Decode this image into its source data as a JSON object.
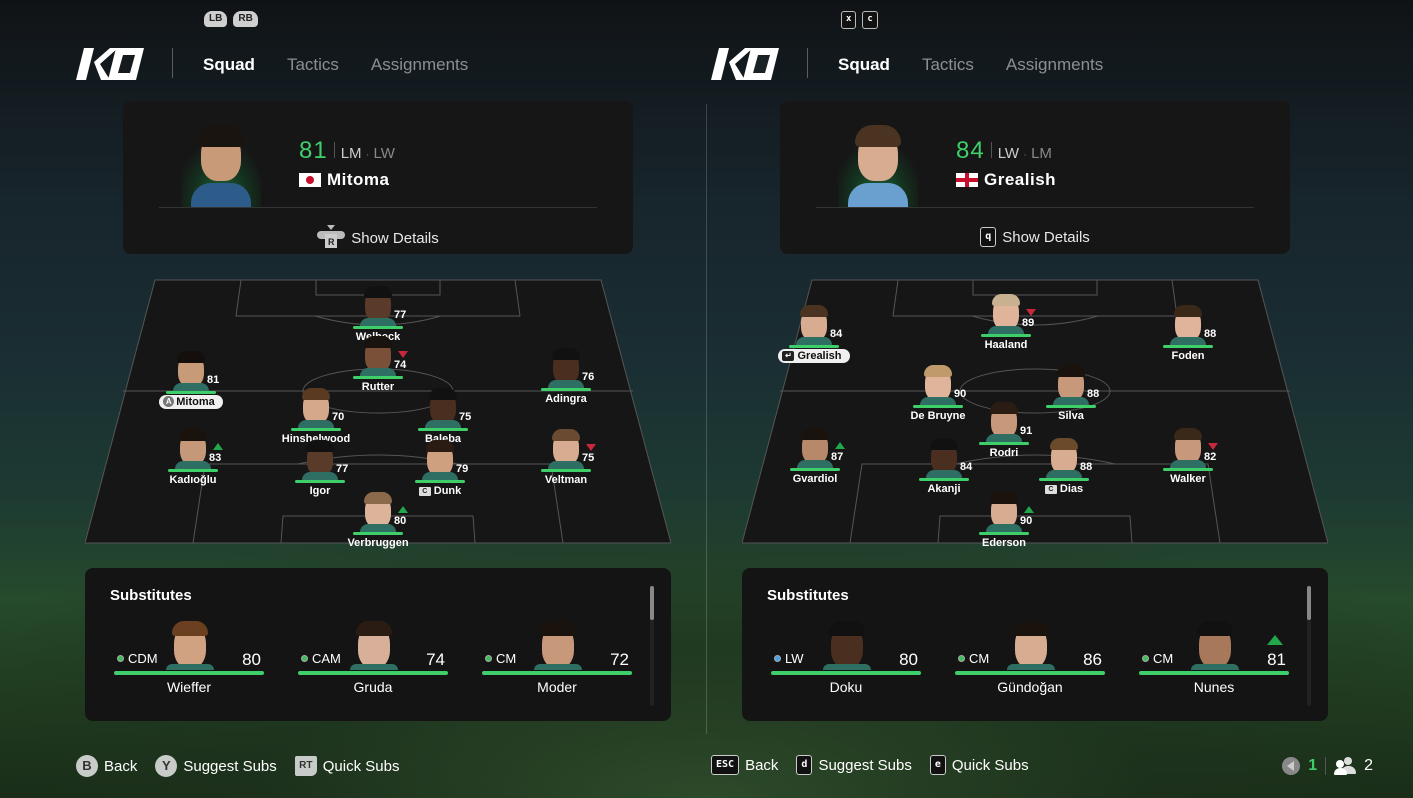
{
  "panels": [
    {
      "bumpers": [
        "LB",
        "RB"
      ],
      "tabs": [
        "Squad",
        "Tactics",
        "Assignments"
      ],
      "active_tab": "Squad",
      "selected_player": {
        "rating": "81",
        "primary_position": "LM",
        "secondary_position": "LW",
        "name": "Mitoma",
        "nationality_flag": "japan-flag",
        "details_hint": "R",
        "details_label": "Show Details"
      },
      "lineup": [
        {
          "name": "Welbeck",
          "rating": "77",
          "trend": "none",
          "badge": "none"
        },
        {
          "name": "Rutter",
          "rating": "74",
          "trend": "down",
          "badge": "none"
        },
        {
          "name": "Mitoma",
          "rating": "81",
          "trend": "none",
          "badge": "A",
          "selected": true
        },
        {
          "name": "Adingra",
          "rating": "76",
          "trend": "none",
          "badge": "none"
        },
        {
          "name": "Hinshelwood",
          "rating": "70",
          "trend": "none",
          "badge": "none"
        },
        {
          "name": "Baleba",
          "rating": "75",
          "trend": "none",
          "badge": "none"
        },
        {
          "name": "Kadıoğlu",
          "rating": "83",
          "trend": "up",
          "badge": "none"
        },
        {
          "name": "Igor",
          "rating": "77",
          "trend": "none",
          "badge": "none"
        },
        {
          "name": "Dunk",
          "rating": "79",
          "trend": "none",
          "badge": "captain"
        },
        {
          "name": "Veltman",
          "rating": "75",
          "trend": "down",
          "badge": "none"
        },
        {
          "name": "Verbruggen",
          "rating": "80",
          "trend": "up",
          "badge": "none"
        }
      ],
      "substitutes_title": "Substitutes",
      "substitutes": [
        {
          "position": "CDM",
          "rating": "80",
          "name": "Wieffer",
          "pos_color": "green",
          "trend": "none"
        },
        {
          "position": "CAM",
          "rating": "74",
          "name": "Gruda",
          "pos_color": "green",
          "trend": "none"
        },
        {
          "position": "CM",
          "rating": "72",
          "name": "Moder",
          "pos_color": "green",
          "trend": "none"
        }
      ],
      "footer": [
        {
          "key": "B",
          "label": "Back"
        },
        {
          "key": "Y",
          "label": "Suggest Subs"
        },
        {
          "key": "RT",
          "label": "Quick Subs"
        }
      ]
    },
    {
      "bumpers": [
        "x",
        "c"
      ],
      "tabs": [
        "Squad",
        "Tactics",
        "Assignments"
      ],
      "active_tab": "Squad",
      "selected_player": {
        "rating": "84",
        "primary_position": "LW",
        "secondary_position": "LM",
        "name": "Grealish",
        "nationality_flag": "england-flag",
        "details_hint": "q",
        "details_label": "Show Details"
      },
      "lineup": [
        {
          "name": "Grealish",
          "rating": "84",
          "trend": "none",
          "badge": "key",
          "selected": true
        },
        {
          "name": "Haaland",
          "rating": "89",
          "trend": "down",
          "badge": "none"
        },
        {
          "name": "Foden",
          "rating": "88",
          "trend": "none",
          "badge": "none"
        },
        {
          "name": "De Bruyne",
          "rating": "90",
          "trend": "none",
          "badge": "none"
        },
        {
          "name": "Silva",
          "rating": "88",
          "trend": "none",
          "badge": "none"
        },
        {
          "name": "Rodri",
          "rating": "91",
          "trend": "none",
          "badge": "none"
        },
        {
          "name": "Gvardiol",
          "rating": "87",
          "trend": "up",
          "badge": "none"
        },
        {
          "name": "Akanji",
          "rating": "84",
          "trend": "none",
          "badge": "none"
        },
        {
          "name": "Dias",
          "rating": "88",
          "trend": "none",
          "badge": "captain"
        },
        {
          "name": "Walker",
          "rating": "82",
          "trend": "down",
          "badge": "none"
        },
        {
          "name": "Ederson",
          "rating": "90",
          "trend": "up",
          "badge": "none"
        }
      ],
      "substitutes_title": "Substitutes",
      "substitutes": [
        {
          "position": "LW",
          "rating": "80",
          "name": "Doku",
          "pos_color": "blue",
          "trend": "none"
        },
        {
          "position": "CM",
          "rating": "86",
          "name": "Gündoğan",
          "pos_color": "green",
          "trend": "none"
        },
        {
          "position": "CM",
          "rating": "81",
          "name": "Nunes",
          "pos_color": "green",
          "trend": "up"
        }
      ],
      "footer": [
        {
          "key": "ESC",
          "label": "Back"
        },
        {
          "key": "d",
          "label": "Suggest Subs"
        },
        {
          "key": "e",
          "label": "Quick Subs"
        }
      ]
    }
  ],
  "status": {
    "voice_count": "1",
    "players_count": "2"
  },
  "colors": {
    "accent_green": "#3ecf6a",
    "trend_up": "#22a84a",
    "trend_down": "#c8283c"
  }
}
